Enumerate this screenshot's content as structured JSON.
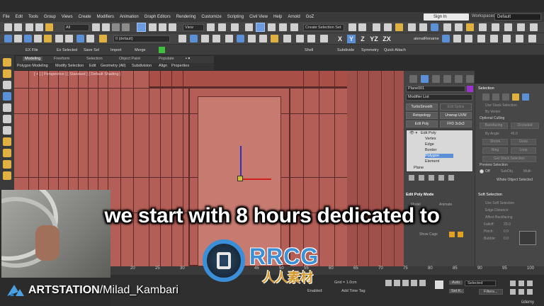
{
  "menu": [
    "File",
    "Edit",
    "Tools",
    "Group",
    "Views",
    "Create",
    "Modifiers",
    "Animation",
    "Graph Editors",
    "Rendering",
    "Customize",
    "Scripting",
    "Civil View",
    "Help",
    "Arnold",
    "GoZ"
  ],
  "account": {
    "signin_label": "Sign In",
    "workspace_label": "Workspaces:",
    "workspace_value": "Default"
  },
  "toolbar": {
    "filter_dropdown": "All",
    "view_dropdown": "View",
    "selection_set": "Create Selection Set",
    "layer_dropdown": "0 (default)",
    "axis_x": "X",
    "axis_y": "Y",
    "axis_z": "Z",
    "axis_xy": "XY",
    "axis_yz": "YZ",
    "axis_zx": "ZX",
    "rename_label": "atenalRename"
  },
  "toolbar3": [
    "EX File",
    "Ex Selected",
    "Save Sel",
    "Import",
    "Merge",
    "Shell",
    "Subdivide",
    "Symmetry",
    "Quick Attach"
  ],
  "ribbon": {
    "tabs": [
      "Modeling",
      "Freeform",
      "Selection",
      "Object Paint",
      "Populate"
    ],
    "subtabs": [
      "Polygon Modeling",
      "Modify Selection",
      "Edit",
      "Geometry (All)",
      "Subdivision",
      "Align",
      "Properties"
    ]
  },
  "viewport": {
    "label": "[ + ] [ Perspective ] [ Standard ] [ Default Shading ]"
  },
  "command_panel": {
    "object_name": "Plane001",
    "modifier_list": "Modifier List",
    "buttons": [
      {
        "label": "TurboSmooth",
        "dim": false
      },
      {
        "label": "Edit Spline",
        "dim": true
      },
      {
        "label": "Retopology",
        "dim": false
      },
      {
        "label": "Unwrap UVW",
        "dim": false
      },
      {
        "label": "Edit Poly",
        "dim": false
      },
      {
        "label": "FFD 3x3x3",
        "dim": false
      }
    ],
    "stack": [
      {
        "label": "Edit Poly",
        "indent": 0,
        "selected": false
      },
      {
        "label": "Vertex",
        "indent": 1,
        "selected": false
      },
      {
        "label": "Edge",
        "indent": 1,
        "selected": false
      },
      {
        "label": "Border",
        "indent": 1,
        "selected": false
      },
      {
        "label": "Polygon",
        "indent": 1,
        "selected": true
      },
      {
        "label": "Element",
        "indent": 1,
        "selected": false
      },
      {
        "label": "Plane",
        "indent": 0,
        "selected": false
      }
    ],
    "epm_header": "Edit Poly Mode",
    "epm_rows": [
      "Model",
      "Animate",
      "Show Cage"
    ]
  },
  "selection_panel": {
    "header": "Selection",
    "use_stack": "Use Stack Selection",
    "by_vertex": "By Vertex",
    "optional_culling": "Optional Culling",
    "backface": "Backfacing",
    "occluded": "Occluded",
    "by_angle": "By Angle",
    "angle_value": "45.0",
    "shrink": "Shrink",
    "grow": "Grow",
    "ring": "Ring",
    "loop": "Loop",
    "get_stack": "Get Stack Selection",
    "preview_selection": "Preview Selection",
    "off": "Off",
    "subobj": "SubObj",
    "multi": "Multi",
    "whole_selected": "Whole Object Selected",
    "soft_header": "Soft Selection",
    "use_soft": "Use Soft Selection",
    "edge_distance": "Edge Distance",
    "affect_backfacing": "Affect Backfacing",
    "falloff_label": "Falloff:",
    "falloff_value": "20.0",
    "pinch_label": "Pinch:",
    "pinch_value": "0.0",
    "bubble_label": "Bubble:",
    "bubble_value": "0.0"
  },
  "timeline": {
    "ticks": [
      "20",
      "25",
      "30",
      "35",
      "40",
      "45",
      "50",
      "55",
      "60",
      "65",
      "70",
      "75",
      "80",
      "85",
      "90",
      "95",
      "100"
    ]
  },
  "status": {
    "grid": "Grid = 1.0cm",
    "enabled": "Enabled:",
    "add_time_tag": "Add Time Tag",
    "auto": "Auto",
    "selected": "Selected",
    "set_k": "Set K.",
    "filters": "Filters..."
  },
  "subtitle": "we start with 8 hours dedicated to",
  "watermark": {
    "text": "RRCG",
    "cn": "人人素材"
  },
  "branding": {
    "artstation": "ARTSTATION",
    "author": "/Milad_Kambari",
    "udemy": "ûdemy"
  },
  "colors": {
    "accent": "#5b8fd6",
    "viewport_mesh": "#b35e56",
    "object_color": "#9933cc"
  }
}
